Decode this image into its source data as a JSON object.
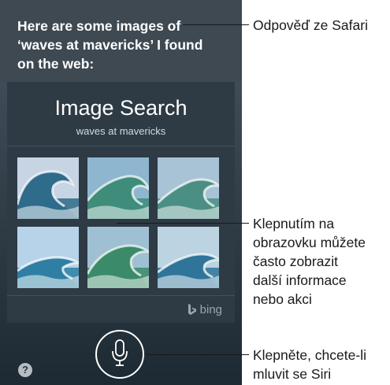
{
  "siri": {
    "response_lines": [
      "Here are some images of",
      "‘waves at mavericks’ I found",
      "on the web:"
    ]
  },
  "card": {
    "title": "Image Search",
    "query": "waves at mavericks",
    "provider": "bing",
    "images": [
      {
        "name": "wave-image-1",
        "sky": "#c7d4e4",
        "water": "#2f6b8a",
        "foam": "#f4f8fb"
      },
      {
        "name": "wave-image-2",
        "sky": "#8fb6cf",
        "water": "#3f8c7a",
        "foam": "#eef6f2"
      },
      {
        "name": "wave-image-3",
        "sky": "#a9c3d6",
        "water": "#4b8f84",
        "foam": "#f1f6f5"
      },
      {
        "name": "wave-image-4",
        "sky": "#b7d3ea",
        "water": "#2e7fa3",
        "foam": "#f6fafc"
      },
      {
        "name": "wave-image-5",
        "sky": "#9fc0d3",
        "water": "#3b8a6a",
        "foam": "#ecf5ef"
      },
      {
        "name": "wave-image-6",
        "sky": "#bcd3e1",
        "water": "#2f7499",
        "foam": "#f3f7fa"
      }
    ]
  },
  "help": {
    "label": "?"
  },
  "callouts": {
    "safari": [
      "Odpověď ze Safari"
    ],
    "tap_info": [
      "Klepnutím na",
      "obrazovku můžete",
      "často zobrazit",
      "další informace",
      "nebo akci"
    ],
    "mic": [
      "Klepněte, chcete-li",
      "mluvit se Siri"
    ]
  },
  "colors": {
    "screen_top": "#4a5662",
    "screen_bottom": "#1d2a33",
    "card_bg": "#2e3a44",
    "text_white": "#ffffff",
    "callout_text": "#1a1a1a"
  }
}
